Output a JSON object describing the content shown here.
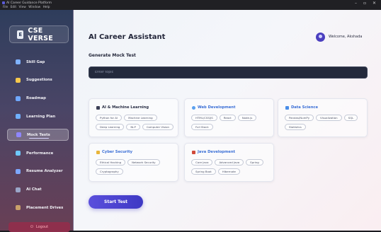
{
  "window": {
    "title": "AI Career Guidance Platform",
    "menu": [
      "File",
      "Edit",
      "View",
      "Window",
      "Help"
    ],
    "controls": {
      "minimize": "–",
      "maximize": "▫",
      "close": "✕"
    }
  },
  "sidebar": {
    "brand": "CSE VERSE",
    "brand_logo": "E",
    "items": [
      {
        "label": "Skill Gap",
        "icon": "target-icon",
        "color": "#7fb2ff"
      },
      {
        "label": "Suggestions",
        "icon": "lightbulb-icon",
        "color": "#f5c84c"
      },
      {
        "label": "Roadmap",
        "icon": "chart-icon",
        "color": "#6fa8ff"
      },
      {
        "label": "Learning Plan",
        "icon": "calendar-icon",
        "color": "#6fb0ff"
      },
      {
        "label": "Mock Tests",
        "icon": "checklist-icon",
        "color": "#8f86ff",
        "active": true
      },
      {
        "label": "Performance",
        "icon": "trend-icon",
        "color": "#6ec9ff"
      },
      {
        "label": "Resume Analyzer",
        "icon": "document-icon",
        "color": "#7da7ff"
      },
      {
        "label": "AI Chat",
        "icon": "robot-icon",
        "color": "#9aa6c8"
      },
      {
        "label": "Placement Drives",
        "icon": "briefcase-icon",
        "color": "#c9a06a"
      }
    ],
    "logout": "Logout"
  },
  "header": {
    "title": "AI Career Assistant",
    "welcome": "Welcome, Akshada"
  },
  "mock_test": {
    "section_title": "Generate Mock Test",
    "input_placeholder": "Enter topic",
    "input_value": "",
    "start_button": "Start Test"
  },
  "cards": [
    {
      "title": "AI & Machine Learning",
      "color": "#2a2f45",
      "icon_color": "#3b3f56",
      "chips": [
        "Python for AI",
        "Machine Learning",
        "Deep Learning",
        "NLP",
        "Computer Vision"
      ]
    },
    {
      "title": "Web Development",
      "color": "#3b6fd6",
      "icon_color": "#5aa0ef",
      "chips": [
        "HTML/CSS/JS",
        "React",
        "Node.js",
        "Full Stack"
      ]
    },
    {
      "title": "Data Science",
      "color": "#3b6fd6",
      "icon_color": "#4a8de8",
      "chips": [
        "Pandas/NumPy",
        "Visualization",
        "SQL",
        "Statistics"
      ]
    },
    {
      "title": "Cyber Security",
      "color": "#3b6fd6",
      "icon_color": "#e8b53a",
      "chips": [
        "Ethical Hacking",
        "Network Security",
        "Cryptography"
      ]
    },
    {
      "title": "Java Development",
      "color": "#3b6fd6",
      "icon_color": "#d04a3a",
      "chips": [
        "Core Java",
        "Advanced Java",
        "Spring",
        "Spring Boot",
        "Hibernate"
      ]
    }
  ]
}
